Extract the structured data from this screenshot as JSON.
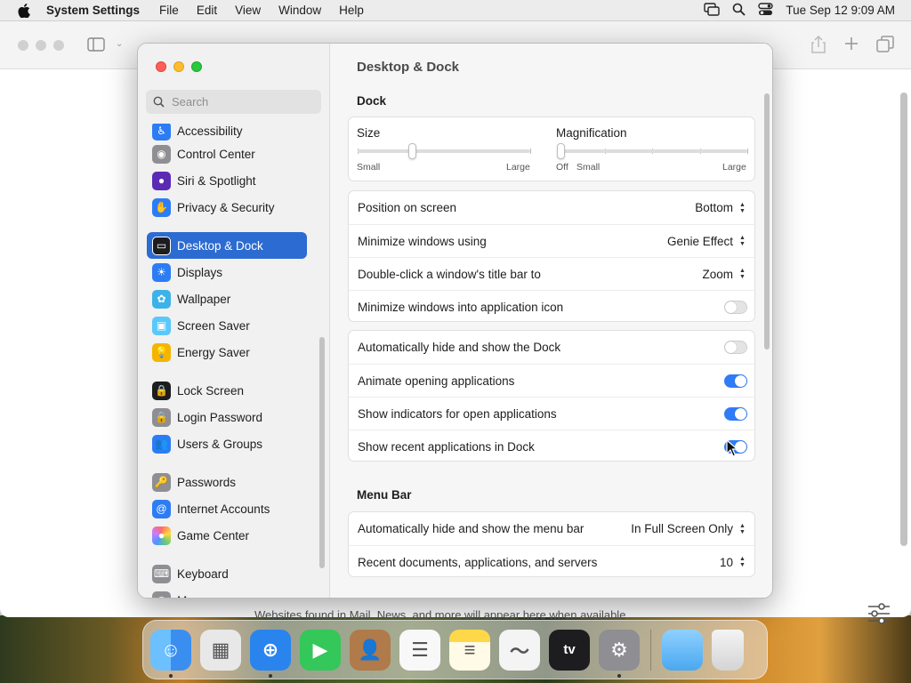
{
  "menubar": {
    "app_name": "System Settings",
    "menus": [
      "File",
      "Edit",
      "View",
      "Window",
      "Help"
    ],
    "clock": "Tue Sep 12  9:09 AM"
  },
  "safari": {
    "footer_text": "Websites found in Mail, News, and more will appear here when available"
  },
  "settings": {
    "search_placeholder": "Search",
    "sidebar": [
      {
        "label": "Accessibility",
        "icon": "accessibility-icon",
        "color": "#2c7cf5"
      },
      {
        "label": "Control Center",
        "icon": "control-center-icon",
        "color": "#8e8e93"
      },
      {
        "label": "Siri & Spotlight",
        "icon": "siri-icon",
        "color": "#5b2bb5"
      },
      {
        "label": "Privacy & Security",
        "icon": "hand-icon",
        "color": "#2c7cf5"
      },
      {
        "label": "Desktop & Dock",
        "icon": "dock-icon",
        "color": "#1d1d1f",
        "selected": true
      },
      {
        "label": "Displays",
        "icon": "sun-icon",
        "color": "#2c7cf5"
      },
      {
        "label": "Wallpaper",
        "icon": "flower-icon",
        "color": "#3bb3e8"
      },
      {
        "label": "Screen Saver",
        "icon": "screen-saver-icon",
        "color": "#5ac8fa"
      },
      {
        "label": "Energy Saver",
        "icon": "bulb-icon",
        "color": "#f5b400"
      },
      {
        "label": "Lock Screen",
        "icon": "lock-icon",
        "color": "#1d1d1f"
      },
      {
        "label": "Login Password",
        "icon": "lock-icon",
        "color": "#8e8e93"
      },
      {
        "label": "Users & Groups",
        "icon": "users-icon",
        "color": "#2c7cf5"
      },
      {
        "label": "Passwords",
        "icon": "key-icon",
        "color": "#8e8e93"
      },
      {
        "label": "Internet Accounts",
        "icon": "at-icon",
        "color": "#2c7cf5"
      },
      {
        "label": "Game Center",
        "icon": "game-center-icon",
        "color": "#ffffff"
      },
      {
        "label": "Keyboard",
        "icon": "keyboard-icon",
        "color": "#8e8e93"
      },
      {
        "label": "Mouse",
        "icon": "mouse-icon",
        "color": "#8e8e93"
      }
    ],
    "title": "Desktop & Dock",
    "dock_section": "Dock",
    "size_label": "Size",
    "size_min": "Small",
    "size_max": "Large",
    "magnification_label": "Magnification",
    "mag_off": "Off",
    "mag_min": "Small",
    "mag_max": "Large",
    "size_value": 0.31,
    "magnification_value": 0.0,
    "group1": [
      {
        "label": "Position on screen",
        "value": "Bottom"
      },
      {
        "label": "Minimize windows using",
        "value": "Genie Effect"
      },
      {
        "label": "Double-click a window's title bar to",
        "value": "Zoom"
      },
      {
        "label": "Minimize windows into application icon",
        "toggle": false
      }
    ],
    "group2": [
      {
        "label": "Automatically hide and show the Dock",
        "toggle": false
      },
      {
        "label": "Animate opening applications",
        "toggle": true
      },
      {
        "label": "Show indicators for open applications",
        "toggle": true
      },
      {
        "label": "Show recent applications in Dock",
        "toggle": true
      }
    ],
    "menubar_section": "Menu Bar",
    "group3": [
      {
        "label": "Automatically hide and show the menu bar",
        "value": "In Full Screen Only"
      },
      {
        "label": "Recent documents, applications, and servers",
        "value": "10"
      }
    ]
  },
  "dock": {
    "apps": [
      {
        "name": "finder-icon",
        "color": "#3a8ef0",
        "running": true
      },
      {
        "name": "launchpad-icon",
        "color": "#e8e8e8",
        "running": false
      },
      {
        "name": "safari-icon",
        "color": "#2a84ee",
        "running": true
      },
      {
        "name": "facetime-icon",
        "color": "#34c759",
        "running": false
      },
      {
        "name": "contacts-icon",
        "color": "#b07a4a",
        "running": false
      },
      {
        "name": "reminders-icon",
        "color": "#f8f8f8",
        "running": false
      },
      {
        "name": "notes-icon",
        "color": "#ffd84a",
        "running": false
      },
      {
        "name": "freeform-icon",
        "color": "#f4f4f4",
        "running": false
      },
      {
        "name": "apple-tv-icon",
        "color": "#1d1d1f",
        "running": false
      },
      {
        "name": "system-settings-icon",
        "color": "#8e8e93",
        "running": true
      }
    ],
    "appletv_label": "tv"
  }
}
